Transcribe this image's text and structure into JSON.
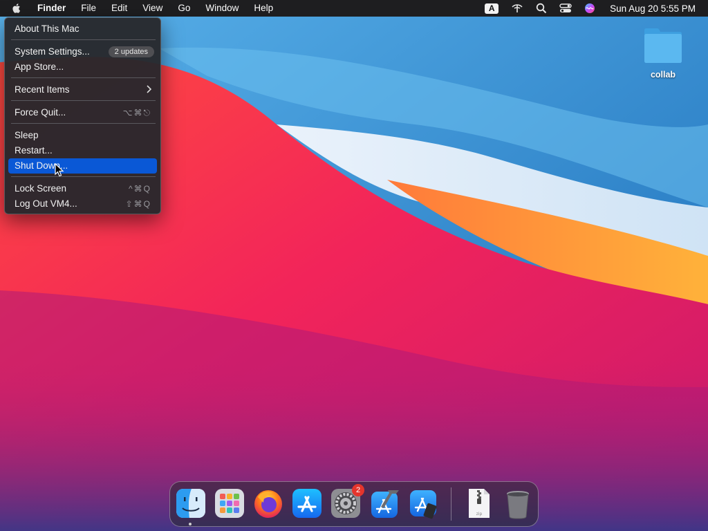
{
  "menubar": {
    "app_name": "Finder",
    "menus": [
      "File",
      "Edit",
      "View",
      "Go",
      "Window",
      "Help"
    ],
    "input_source": "A",
    "clock": "Sun Aug 20  5:55 PM"
  },
  "apple_menu": {
    "about": "About This Mac",
    "system_settings": "System Settings...",
    "updates_badge": "2 updates",
    "app_store": "App Store...",
    "recent_items": "Recent Items",
    "force_quit": "Force Quit...",
    "force_quit_shortcut": "⌥⌘⎋",
    "sleep": "Sleep",
    "restart": "Restart...",
    "shut_down": "Shut Down...",
    "lock_screen": "Lock Screen",
    "lock_screen_shortcut": "^⌘Q",
    "log_out": "Log Out VM4...",
    "log_out_shortcut": "⇧⌘Q"
  },
  "desktop": {
    "folder_label": "collab"
  },
  "dock": {
    "items": [
      "finder",
      "launchpad",
      "firefox",
      "app-store",
      "system-settings",
      "xcode",
      "simulator",
      "zip-archive",
      "trash"
    ],
    "system_settings_badge": "2",
    "zip_label": "zip"
  },
  "colors": {
    "menu_highlight": "#0a58d6",
    "menubar_bg": "#1e1e20"
  }
}
